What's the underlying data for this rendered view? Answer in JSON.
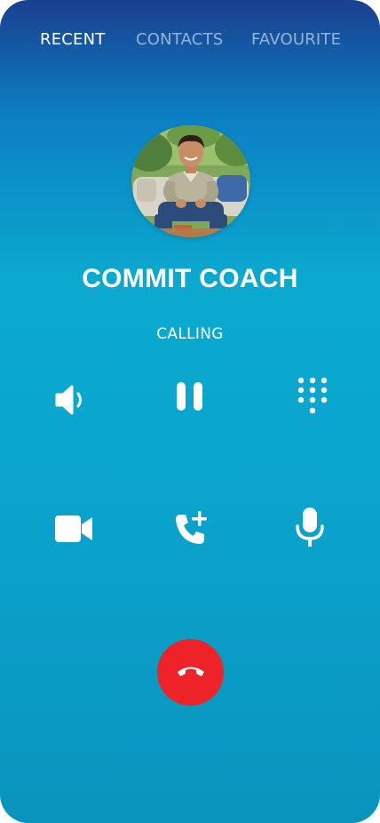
{
  "tabs": {
    "recent": "RECENT",
    "contacts": "CONTACTS",
    "favourite": "FAVOURITE",
    "active": "recent"
  },
  "contact": {
    "name": "COMMIT COACH",
    "status": "CALLING",
    "avatar": "contact-photo"
  },
  "controls": [
    {
      "icon": "speaker-icon"
    },
    {
      "icon": "pause-icon"
    },
    {
      "icon": "dialpad-icon"
    },
    {
      "icon": "video-camera-icon"
    },
    {
      "icon": "add-call-icon"
    },
    {
      "icon": "microphone-icon"
    }
  ],
  "end_call": {
    "icon": "end-call-icon",
    "color": "#ee2329"
  },
  "colors": {
    "background_top": "#1a3f8f",
    "background_main": "#0ba8cf",
    "active_tab": "#ffffff",
    "inactive_tab": "rgba(255,255,255,0.55)"
  }
}
